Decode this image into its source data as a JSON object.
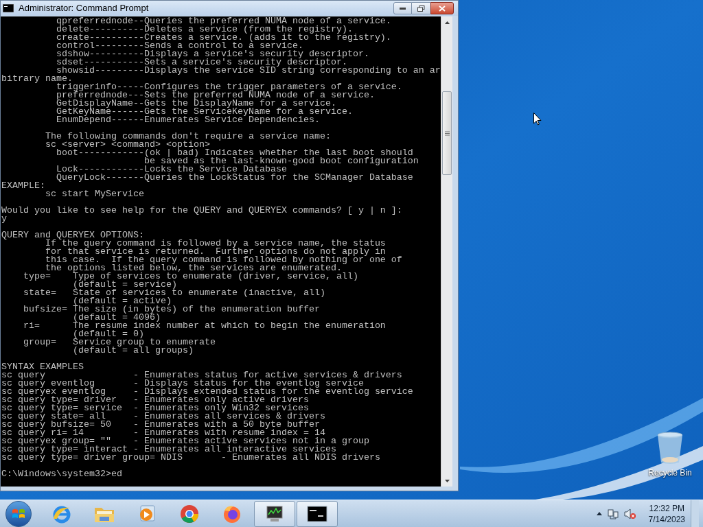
{
  "window": {
    "title": "Administrator: Command Prompt",
    "console": {
      "blocks": [
        [
          "          qpreferrednode--Queries the preferred NUMA node of a service.",
          "          delete----------Deletes a service (from the registry).",
          "          create----------Creates a service. (adds it to the registry).",
          "          control---------Sends a control to a service.",
          "          sdshow----------Displays a service's security descriptor.",
          "          sdset-----------Sets a service's security descriptor.",
          "          showsid---------Displays the service SID string corresponding to an ar",
          "bitrary name.",
          "          triggerinfo-----Configures the trigger parameters of a service.",
          "          preferrednode---Sets the preferred NUMA node of a service.",
          "          GetDisplayName--Gets the DisplayName for a service.",
          "          GetKeyName------Gets the ServiceKeyName for a service.",
          "          EnumDepend------Enumerates Service Dependencies."
        ],
        [
          "        The following commands don't require a service name:",
          "        sc <server> <command> <option>",
          "          boot------------(ok | bad) Indicates whether the last boot should",
          "                          be saved as the last-known-good boot configuration",
          "          Lock------------Locks the Service Database",
          "          QueryLock-------Queries the LockStatus for the SCManager Database",
          "EXAMPLE:",
          "        sc start MyService"
        ],
        [
          "Would you like to see help for the QUERY and QUERYEX commands? [ y | n ]:",
          "y"
        ],
        [
          "QUERY and QUERYEX OPTIONS:",
          "        If the query command is followed by a service name, the status",
          "        for that service is returned.  Further options do not apply in",
          "        this case.  If the query command is followed by nothing or one of",
          "        the options listed below, the services are enumerated.",
          "    type=    Type of services to enumerate (driver, service, all)",
          "             (default = service)",
          "    state=   State of services to enumerate (inactive, all)",
          "             (default = active)",
          "    bufsize= The size (in bytes) of the enumeration buffer",
          "             (default = 4096)",
          "    ri=      The resume index number at which to begin the enumeration",
          "             (default = 0)",
          "    group=   Service group to enumerate",
          "             (default = all groups)"
        ],
        [
          "SYNTAX EXAMPLES",
          "sc query                - Enumerates status for active services & drivers",
          "sc query eventlog       - Displays status for the eventlog service",
          "sc queryex eventlog     - Displays extended status for the eventlog service",
          "sc query type= driver   - Enumerates only active drivers",
          "sc query type= service  - Enumerates only Win32 services",
          "sc query state= all     - Enumerates all services & drivers",
          "sc query bufsize= 50    - Enumerates with a 50 byte buffer",
          "sc query ri= 14         - Enumerates with resume index = 14",
          "sc queryex group= \"\"    - Enumerates active services not in a group",
          "sc query type= interact - Enumerates all interactive services",
          "sc query type= driver group= NDIS       - Enumerates all NDIS drivers"
        ]
      ],
      "prompt": "C:\\Windows\\system32>ed"
    }
  },
  "desktop": {
    "icons": [
      {
        "label": "Recycle Bin"
      }
    ]
  },
  "taskbar": {
    "apps": [
      {
        "kind": "ie",
        "running": false
      },
      {
        "kind": "explorer",
        "running": false
      },
      {
        "kind": "media",
        "running": false
      },
      {
        "kind": "chrome",
        "running": false
      },
      {
        "kind": "firefox",
        "running": false
      },
      {
        "kind": "taskmgr",
        "running": true
      },
      {
        "kind": "cmd",
        "running": true
      }
    ],
    "clock": {
      "time": "12:32 PM",
      "date": "7/14/2023"
    }
  }
}
